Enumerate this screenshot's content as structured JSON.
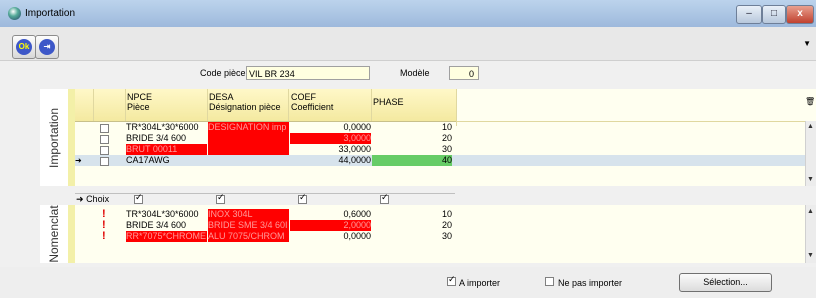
{
  "window": {
    "title": "Importation",
    "minimize": "–",
    "maximize": "□",
    "close": "x"
  },
  "toolbar": {
    "ok_label": "Ok",
    "exit_icon": "exit-icon",
    "menu_icon": "chevron-down-icon"
  },
  "header": {
    "code_piece_label": "Code pièce",
    "code_piece_value": "VIL BR 234",
    "modele_label": "Modèle",
    "modele_value": "0"
  },
  "tabs": {
    "importation": "Importation",
    "nomenclat": "Nomenclat"
  },
  "columns": {
    "npce": "NPCE",
    "npce_sub": "Pièce",
    "desa": "DESA",
    "desa_sub": "Désignation pièce",
    "coef": "COEF",
    "coef_sub": "Coefficient",
    "phase": "PHASE"
  },
  "import_rows": [
    {
      "npce": "TR*304L*30*6000",
      "desa": "DESIGNATION imp",
      "coef": "0,0000",
      "phase": "10",
      "desa_red": true,
      "npce_red": false,
      "coef_red": false
    },
    {
      "npce": "BRIDE 3/4  600",
      "desa": "",
      "coef": "3,0000",
      "phase": "20",
      "desa_red": true,
      "npce_red": false,
      "coef_red": true
    },
    {
      "npce": "BRUT 00011",
      "desa": "",
      "coef": "33,0000",
      "phase": "30",
      "desa_red": true,
      "npce_red": true,
      "coef_red": false
    },
    {
      "npce": "CA17AWG",
      "desa": "",
      "coef": "44,0000",
      "phase": "40",
      "desa_red": false,
      "npce_red": false,
      "coef_red": false,
      "selected": true
    }
  ],
  "choix_label": "Choix",
  "nomen_rows": [
    {
      "npce": "TR*304L*30*6000",
      "desa": "INOX 304L",
      "coef": "0,6000",
      "phase": "10",
      "npce_red": false,
      "coef_red": false
    },
    {
      "npce": "BRIDE 3/4  600",
      "desa": "BRIDE SME 3/4 60I",
      "coef": "2,0000",
      "phase": "20",
      "npce_red": false,
      "coef_red": true
    },
    {
      "npce": "RR*7075*CHROME",
      "desa": "ALU 7075/CHROM",
      "coef": "0,0000",
      "phase": "30",
      "npce_red": true,
      "coef_red": false
    }
  ],
  "bottom": {
    "a_importer": "A importer",
    "ne_pas_importer": "Ne pas importer",
    "selection": "Sélection..."
  },
  "colors": {
    "red": "#ff0000",
    "green": "#66cc66",
    "selected": "#d7e3ec",
    "yellow": "#fff8c8"
  }
}
